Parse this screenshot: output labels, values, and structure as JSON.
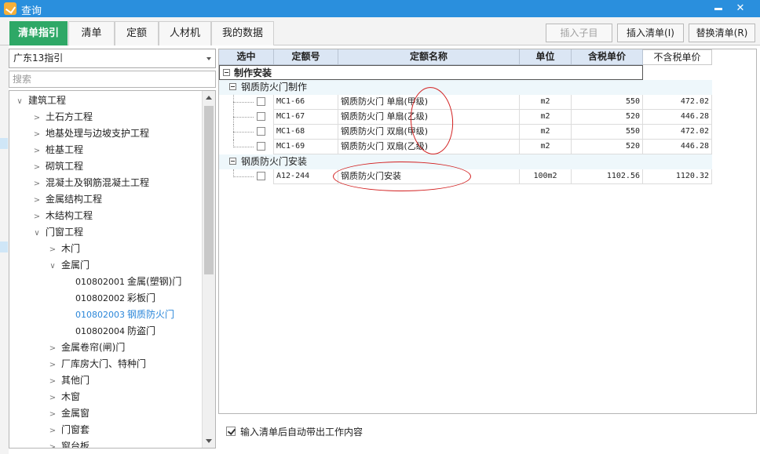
{
  "window": {
    "title": "查询",
    "min_glyph": "—",
    "close_glyph": "✕"
  },
  "tabs": [
    {
      "label": "清单指引",
      "active": true
    },
    {
      "label": "清单"
    },
    {
      "label": "定额"
    },
    {
      "label": "人材机"
    },
    {
      "label": "我的数据"
    }
  ],
  "toolbar": {
    "insert_child": "插入子目",
    "insert_list": "插入清单(I)",
    "replace_list": "替换清单(R)"
  },
  "left": {
    "guide_select": "广东13指引",
    "search_placeholder": "搜索",
    "tree": [
      {
        "label": "建筑工程",
        "level": 0,
        "arrow": "∨"
      },
      {
        "label": "土石方工程",
        "level": 1,
        "arrow": ">"
      },
      {
        "label": "地基处理与边坡支护工程",
        "level": 1,
        "arrow": ">"
      },
      {
        "label": "桩基工程",
        "level": 1,
        "arrow": ">"
      },
      {
        "label": "砌筑工程",
        "level": 1,
        "arrow": ">"
      },
      {
        "label": "混凝土及钢筋混凝土工程",
        "level": 1,
        "arrow": ">"
      },
      {
        "label": "金属结构工程",
        "level": 1,
        "arrow": ">"
      },
      {
        "label": "木结构工程",
        "level": 1,
        "arrow": ">"
      },
      {
        "label": "门窗工程",
        "level": 1,
        "arrow": "∨"
      },
      {
        "label": "木门",
        "level": 2,
        "arrow": ">"
      },
      {
        "label": "金属门",
        "level": 2,
        "arrow": "∨"
      },
      {
        "code": "010802001",
        "label": "金属(塑钢)门",
        "level": 3
      },
      {
        "code": "010802002",
        "label": "彩板门",
        "level": 3
      },
      {
        "code": "010802003",
        "label": "钢质防火门",
        "level": 3,
        "selected": true
      },
      {
        "code": "010802004",
        "label": "防盗门",
        "level": 3
      },
      {
        "label": "金属卷帘(闸)门",
        "level": 2,
        "arrow": ">"
      },
      {
        "label": "厂库房大门、特种门",
        "level": 2,
        "arrow": ">"
      },
      {
        "label": "其他门",
        "level": 2,
        "arrow": ">"
      },
      {
        "label": "木窗",
        "level": 2,
        "arrow": ">"
      },
      {
        "label": "金属窗",
        "level": 2,
        "arrow": ">"
      },
      {
        "label": "门窗套",
        "level": 2,
        "arrow": ">"
      },
      {
        "label": "窗台板",
        "level": 2,
        "arrow": ">"
      }
    ]
  },
  "grid": {
    "columns": [
      "选中",
      "定额号",
      "定额名称",
      "单位",
      "含税单价",
      "不含税单价"
    ],
    "top_group": "制作安装",
    "groups": [
      {
        "label": "钢质防火门制作",
        "rows": [
          {
            "code": "MC1-66",
            "name_a": "钢质防火门 单扇",
            "name_b": "(甲级)",
            "unit": "m2",
            "tax_price": "550",
            "notax_price": "472.02"
          },
          {
            "code": "MC1-67",
            "name_a": "钢质防火门 单扇",
            "name_b": "(乙级)",
            "unit": "m2",
            "tax_price": "520",
            "notax_price": "446.28"
          },
          {
            "code": "MC1-68",
            "name_a": "钢质防火门 双扇",
            "name_b": "(甲级)",
            "unit": "m2",
            "tax_price": "550",
            "notax_price": "472.02"
          },
          {
            "code": "MC1-69",
            "name_a": "钢质防火门 双扇",
            "name_b": "(乙级)",
            "unit": "m2",
            "tax_price": "520",
            "notax_price": "446.28"
          }
        ]
      },
      {
        "label": "钢质防火门安装",
        "rows": [
          {
            "code": "A12-244",
            "name_a": "钢质防火门安装",
            "name_b": "",
            "unit": "100m2",
            "tax_price": "1102.56",
            "notax_price": "1120.32"
          }
        ]
      }
    ]
  },
  "footer": {
    "auto_content_label": "输入清单后自动带出工作内容",
    "checked": true
  },
  "colors": {
    "titlebar": "#2a8fdd",
    "active_tab": "#2ea866",
    "selected_node": "#2a86d9",
    "annotation": "#d21f1f"
  }
}
